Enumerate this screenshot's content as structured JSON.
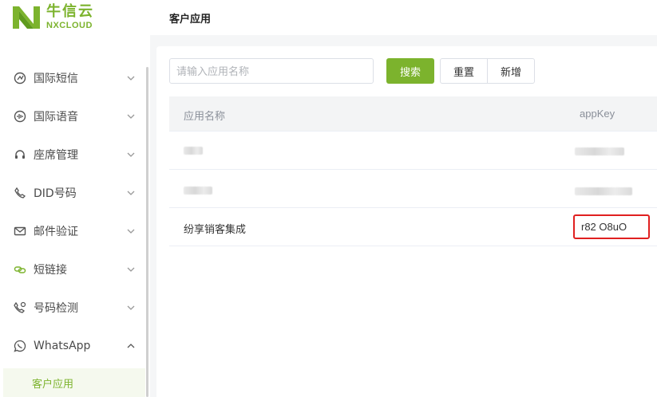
{
  "brand": {
    "name_cn": "牛信云",
    "name_en": "NXCLOUD",
    "color": "#7cb32d"
  },
  "header": {
    "title": "客户应用"
  },
  "sidebar": {
    "items": [
      {
        "label": "国际短信",
        "icon": "sms-icon",
        "expanded": false
      },
      {
        "label": "国际语音",
        "icon": "voice-icon",
        "expanded": false
      },
      {
        "label": "座席管理",
        "icon": "headset-icon",
        "expanded": false
      },
      {
        "label": "DID号码",
        "icon": "phone-icon",
        "expanded": false
      },
      {
        "label": "邮件验证",
        "icon": "mail-icon",
        "expanded": false
      },
      {
        "label": "短链接",
        "icon": "link-icon",
        "expanded": false
      },
      {
        "label": "号码检测",
        "icon": "phone-check-icon",
        "expanded": false
      },
      {
        "label": "WhatsApp",
        "icon": "whatsapp-icon",
        "expanded": true
      }
    ],
    "active_sub_item": "客户应用"
  },
  "search": {
    "placeholder": "请输入应用名称",
    "value": ""
  },
  "toolbar": {
    "search_label": "搜索",
    "reset_label": "重置",
    "add_label": "新增"
  },
  "table": {
    "columns": [
      "应用名称",
      "appKey"
    ],
    "rows": [
      {
        "name": "",
        "appKey": ""
      },
      {
        "name": "",
        "appKey": ""
      },
      {
        "name": "纷享销客集成",
        "appKey": "r82 O8uO"
      }
    ]
  }
}
